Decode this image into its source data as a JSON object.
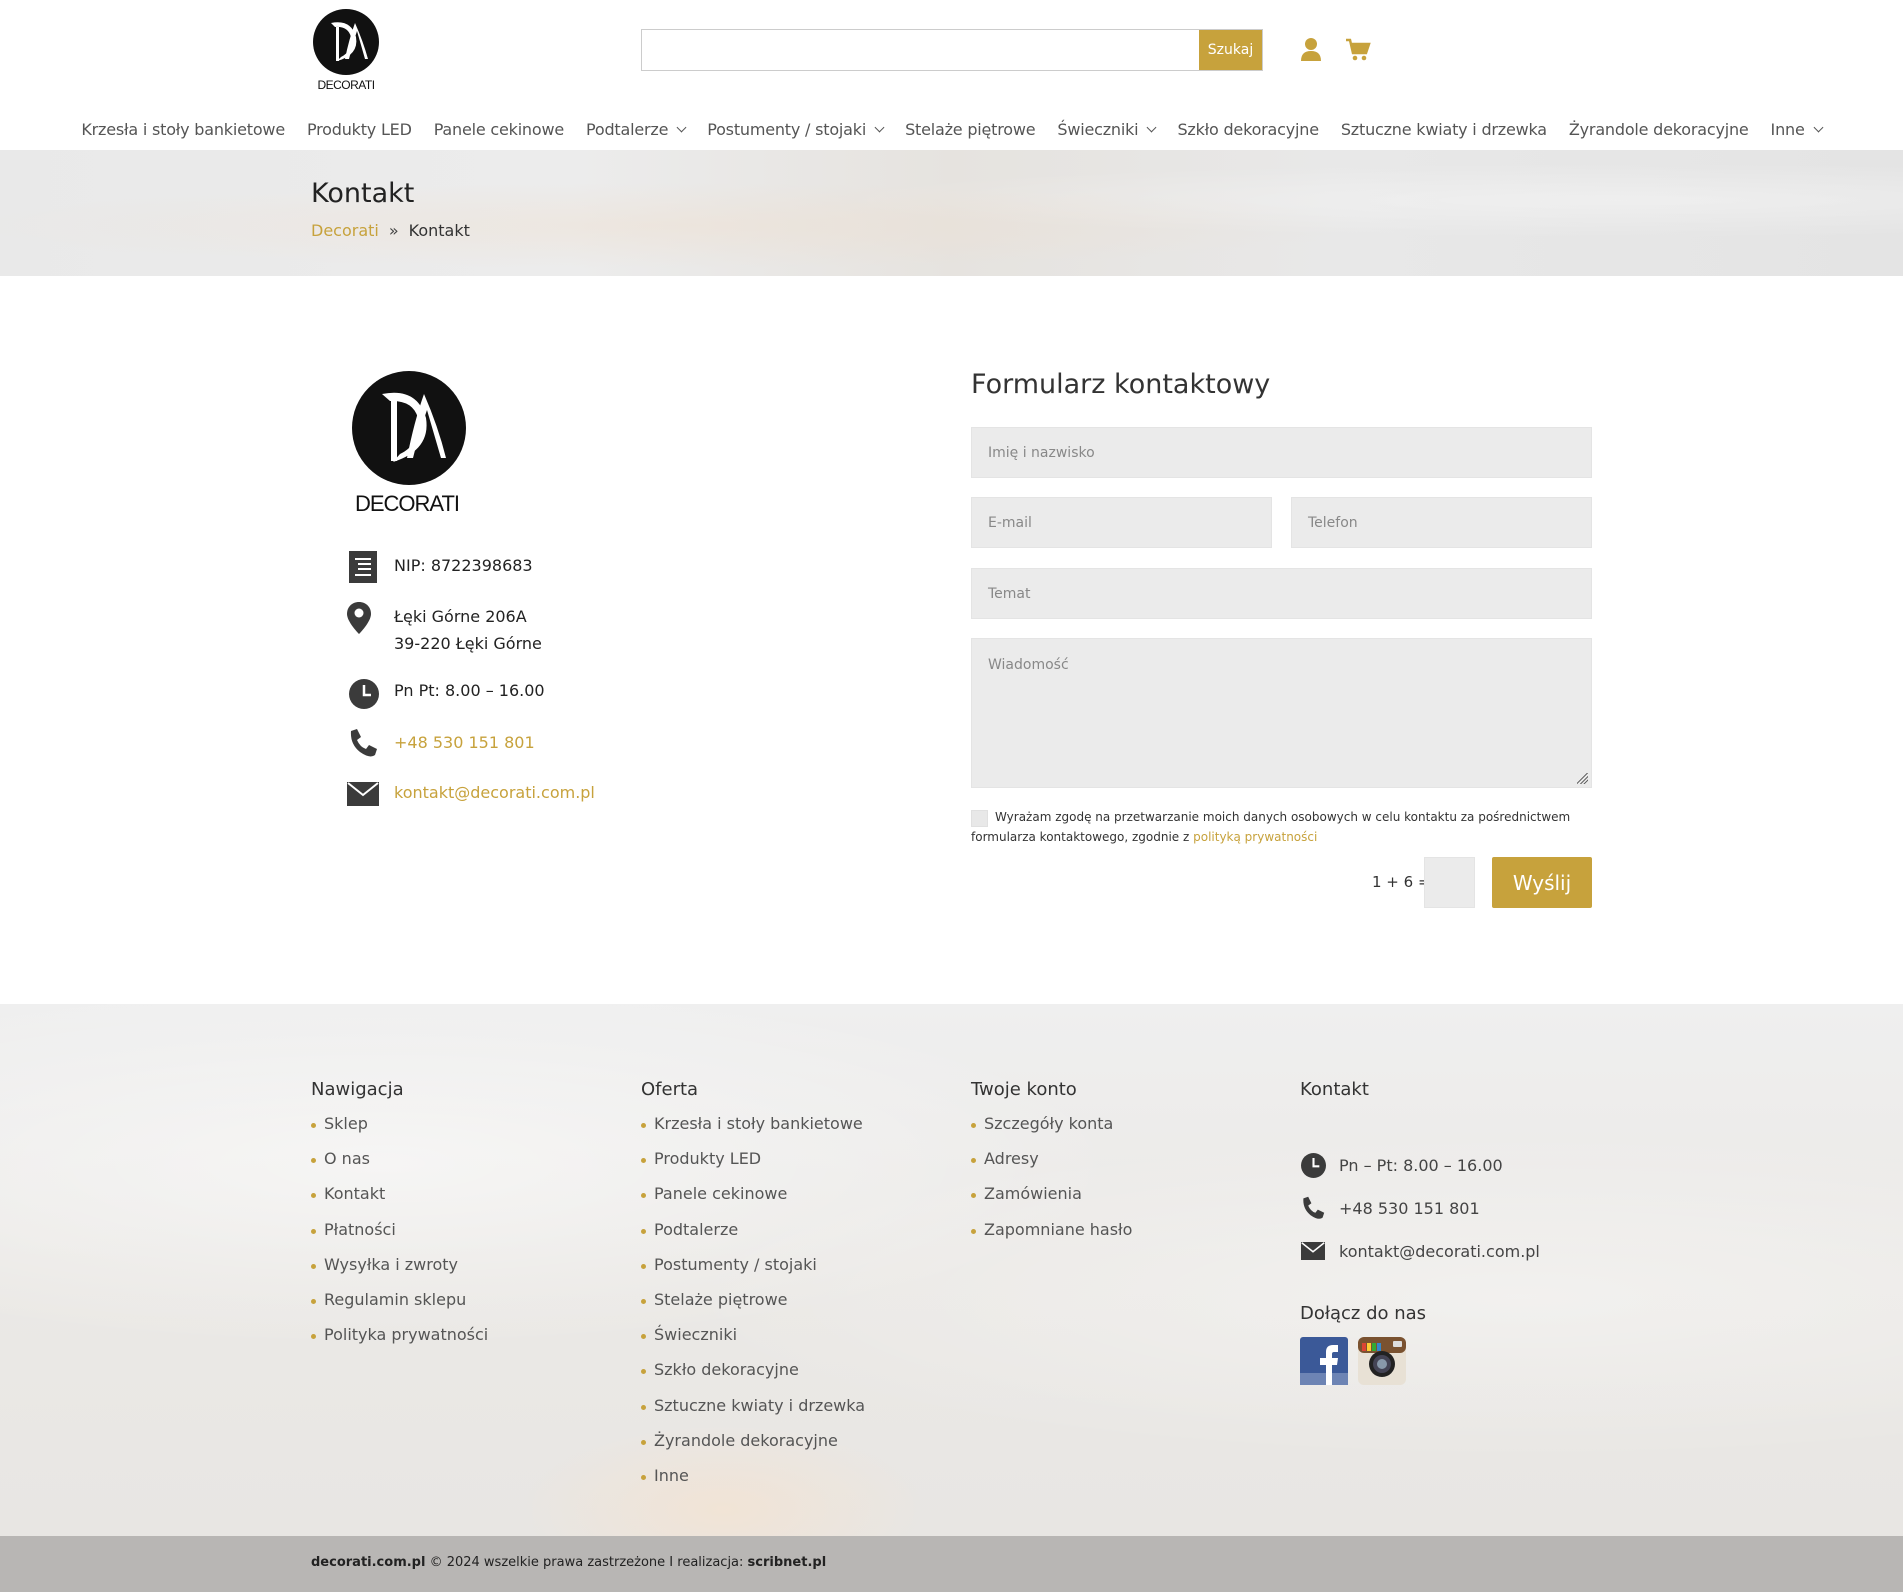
{
  "header": {
    "logo_text": "DECORATI",
    "search": {
      "placeholder": "",
      "value": "",
      "button_label": "Szukaj"
    }
  },
  "nav": {
    "items": [
      {
        "label": "Krzesła i stoły bankietowe",
        "has_dropdown": false
      },
      {
        "label": "Produkty LED",
        "has_dropdown": false
      },
      {
        "label": "Panele cekinowe",
        "has_dropdown": false
      },
      {
        "label": "Podtalerze",
        "has_dropdown": true
      },
      {
        "label": "Postumenty / stojaki",
        "has_dropdown": true
      },
      {
        "label": "Stelaże piętrowe",
        "has_dropdown": false
      },
      {
        "label": "Świeczniki",
        "has_dropdown": true
      },
      {
        "label": "Szkło dekoracyjne",
        "has_dropdown": false
      },
      {
        "label": "Sztuczne kwiaty i drzewka",
        "has_dropdown": false
      },
      {
        "label": "Żyrandole dekoracyjne",
        "has_dropdown": false
      },
      {
        "label": "Inne",
        "has_dropdown": true
      }
    ]
  },
  "banner": {
    "title": "Kontakt",
    "breadcrumb": {
      "home": "Decorati",
      "separator": "»",
      "current": "Kontakt"
    }
  },
  "contact_info": {
    "nip": "NIP: 8722398683",
    "address_line1": "Łęki Górne 206A",
    "address_line2": "39-220 Łęki Górne",
    "hours": "Pn  Pt: 8.00 – 16.00",
    "phone": "+48 530 151 801",
    "email": "kontakt@decorati.com.pl"
  },
  "form": {
    "title": "Formularz kontaktowy",
    "name_placeholder": "Imię i nazwisko",
    "email_placeholder": "E-mail",
    "phone_placeholder": "Telefon",
    "subject_placeholder": "Temat",
    "message_placeholder": "Wiadomość",
    "consent_text": "Wyrażam zgodę na przetwarzanie moich danych osobowych w celu kontaktu za pośrednictwem formularza kontaktowego, zgodnie z",
    "consent_link": "polityką prywatności",
    "captcha_label": "1 + 6 =",
    "submit_label": "Wyślij"
  },
  "footer": {
    "nav": {
      "title": "Nawigacja",
      "items": [
        "Sklep",
        "O nas",
        "Kontakt",
        "Płatności",
        "Wysyłka i zwroty",
        "Regulamin sklepu",
        "Polityka prywatności"
      ]
    },
    "offer": {
      "title": "Oferta",
      "items": [
        "Krzesła i stoły bankietowe",
        "Produkty LED",
        "Panele cekinowe",
        "Podtalerze",
        "Postumenty / stojaki",
        "Stelaże piętrowe",
        "Świeczniki",
        "Szkło dekoracyjne",
        "Sztuczne kwiaty i drzewka",
        "Żyrandole dekoracyjne",
        "Inne"
      ]
    },
    "account": {
      "title": "Twoje konto",
      "items": [
        "Szczegóły konta",
        "Adresy",
        "Zamówienia",
        "Zapomniane hasło"
      ]
    },
    "contact": {
      "title": "Kontakt",
      "hours": "Pn – Pt: 8.00 – 16.00",
      "phone": "+48 530 151 801",
      "email": "kontakt@decorati.com.pl",
      "social_title": "Dołącz do nas"
    },
    "copyright": {
      "site": "decorati.com.pl",
      "text": " © 2024 wszelkie prawa zastrzeżone I realizacja: ",
      "author": "scribnet.pl"
    }
  },
  "colors": {
    "accent": "#c7a23c",
    "icon_dark": "#3b3b3b",
    "footer_bar": "#b8b6b4"
  }
}
